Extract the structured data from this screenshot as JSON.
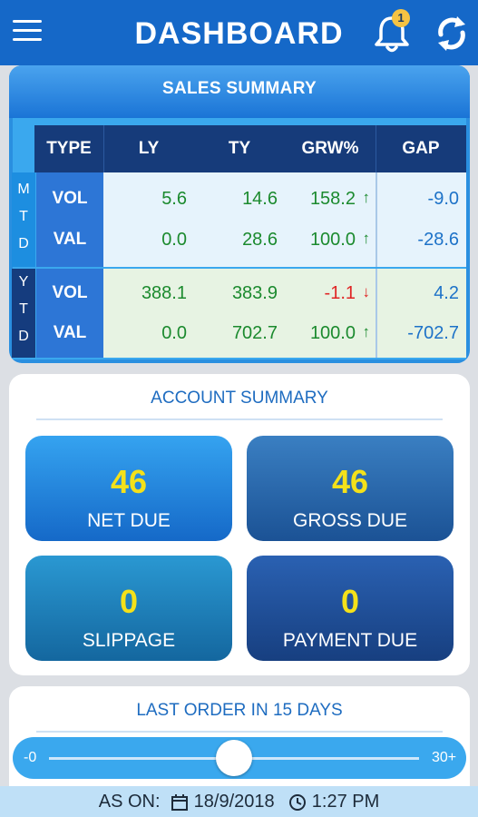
{
  "header": {
    "title": "DASHBOARD",
    "notification_count": "1",
    "menu_icon": "hamburger-icon",
    "bell_icon": "bell-icon",
    "refresh_icon": "refresh-icon"
  },
  "sales_summary": {
    "title": "SALES SUMMARY",
    "columns": [
      "TYPE",
      "LY",
      "TY",
      "GRW%",
      "GAP"
    ],
    "mtd_letters": [
      "M",
      "T",
      "D"
    ],
    "ytd_letters": [
      "Y",
      "T",
      "D"
    ],
    "mtd": [
      {
        "type": "VOL",
        "ly": "5.6",
        "ty": "14.6",
        "grw": "158.2",
        "grw_dir": "up",
        "gap": "-9.0"
      },
      {
        "type": "VAL",
        "ly": "0.0",
        "ty": "28.6",
        "grw": "100.0",
        "grw_dir": "up",
        "gap": "-28.6"
      }
    ],
    "ytd": [
      {
        "type": "VOL",
        "ly": "388.1",
        "ty": "383.9",
        "grw": "-1.1",
        "grw_dir": "down",
        "gap": "4.2"
      },
      {
        "type": "VAL",
        "ly": "0.0",
        "ty": "702.7",
        "grw": "100.0",
        "grw_dir": "up",
        "gap": "-702.7"
      }
    ]
  },
  "account_summary": {
    "title": "ACCOUNT SUMMARY",
    "tiles": [
      {
        "value": "46",
        "label": "NET DUE"
      },
      {
        "value": "46",
        "label": "GROSS DUE"
      },
      {
        "value": "0",
        "label": "SLIPPAGE"
      },
      {
        "value": "0",
        "label": "PAYMENT DUE"
      }
    ]
  },
  "last_order": {
    "title": "LAST ORDER IN 15 DAYS",
    "min_label": "-0",
    "max_label": "30+",
    "slider_value": 15,
    "slider_max": 30
  },
  "footer": {
    "as_on_label": "AS ON:",
    "date": "18/9/2018",
    "time": "1:27 PM",
    "calendar_icon": "calendar-icon",
    "clock_icon": "clock-icon"
  },
  "colors": {
    "header_blue": "#1568c8",
    "accent_yellow": "#f4e11a",
    "growth_green": "#1b8a2e",
    "decline_red": "#e02525",
    "gap_blue": "#1d72c8"
  }
}
